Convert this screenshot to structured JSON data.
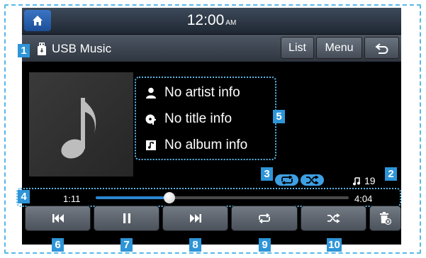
{
  "clock": {
    "time": "12:00",
    "ampm": "AM"
  },
  "header": {
    "title": "USB Music",
    "list_label": "List",
    "menu_label": "Menu"
  },
  "track_info": {
    "artist": "No artist info",
    "title": "No title info",
    "album": "No album info"
  },
  "playback": {
    "elapsed": "1:11",
    "total": "4:04",
    "progress_fraction": 0.29,
    "track_count": "19"
  },
  "callouts": [
    "1",
    "2",
    "3",
    "4",
    "5",
    "6",
    "7",
    "8",
    "9",
    "10"
  ],
  "colors": {
    "accent": "#2e95d8",
    "callout_outline": "#59b8e6",
    "progress_fill": "#2c86d4"
  },
  "icons": [
    "home-icon",
    "usb-icon",
    "back-icon",
    "artist-icon",
    "title-icon",
    "album-icon",
    "repeat-icon",
    "shuffle-icon",
    "note-icon",
    "previous-icon",
    "pause-icon",
    "next-icon",
    "delete-icon"
  ]
}
